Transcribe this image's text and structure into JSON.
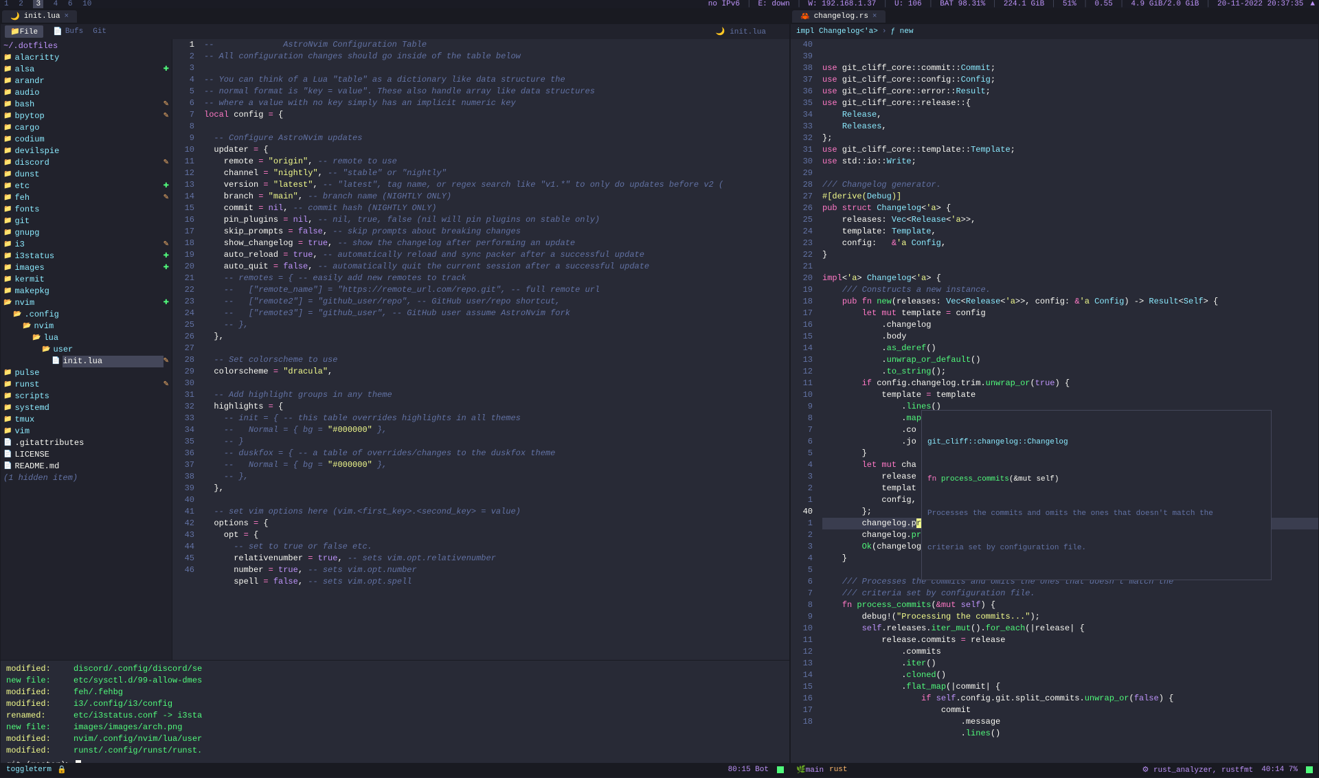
{
  "topbar": {
    "workspaces": [
      "1",
      "2",
      "3",
      "4",
      "6",
      "10"
    ],
    "active_ws": "3",
    "ipv6": "no IPv6",
    "eth": "E: down",
    "wifi": "W: 192.168.1.37",
    "up": "U: 106",
    "bat": "BAT 98.31%",
    "disk": "224.1 GiB",
    "diskpct": "51%",
    "load": "0.55",
    "mem": "4.9 GiB/2.0 GiB",
    "date": "20-11-2022 20:37:35",
    "tray": "▲"
  },
  "left": {
    "tab": {
      "name": "init.lua",
      "active": true
    },
    "mode": {
      "file": "📁File",
      "bufs": "Bufs",
      "git": "Git"
    },
    "breadcrumb": "🌙 init.lua",
    "tree": {
      "header": "~/.dotfiles",
      "items": [
        {
          "n": "alacritty",
          "i": 0,
          "t": "d",
          "m": ""
        },
        {
          "n": "alsa",
          "i": 0,
          "t": "d",
          "m": "+"
        },
        {
          "n": "arandr",
          "i": 0,
          "t": "d",
          "m": ""
        },
        {
          "n": "audio",
          "i": 0,
          "t": "d",
          "m": ""
        },
        {
          "n": "bash",
          "i": 0,
          "t": "d",
          "m": "~"
        },
        {
          "n": "bpytop",
          "i": 0,
          "t": "d",
          "m": "~"
        },
        {
          "n": "cargo",
          "i": 0,
          "t": "d",
          "m": ""
        },
        {
          "n": "codium",
          "i": 0,
          "t": "d",
          "m": ""
        },
        {
          "n": "devilspie",
          "i": 0,
          "t": "d",
          "m": ""
        },
        {
          "n": "discord",
          "i": 0,
          "t": "d",
          "m": "~"
        },
        {
          "n": "dunst",
          "i": 0,
          "t": "d",
          "m": ""
        },
        {
          "n": "etc",
          "i": 0,
          "t": "d",
          "m": "+"
        },
        {
          "n": "feh",
          "i": 0,
          "t": "d",
          "m": "~"
        },
        {
          "n": "fonts",
          "i": 0,
          "t": "d",
          "m": ""
        },
        {
          "n": "git",
          "i": 0,
          "t": "d",
          "m": ""
        },
        {
          "n": "gnupg",
          "i": 0,
          "t": "d",
          "m": ""
        },
        {
          "n": "i3",
          "i": 0,
          "t": "d",
          "m": "~"
        },
        {
          "n": "i3status",
          "i": 0,
          "t": "d",
          "m": "+"
        },
        {
          "n": "images",
          "i": 0,
          "t": "d",
          "m": "+"
        },
        {
          "n": "kermit",
          "i": 0,
          "t": "d",
          "m": ""
        },
        {
          "n": "makepkg",
          "i": 0,
          "t": "d",
          "m": ""
        },
        {
          "n": "nvim",
          "i": 0,
          "t": "d",
          "m": "+",
          "open": true
        },
        {
          "n": ".config",
          "i": 1,
          "t": "d",
          "m": "",
          "open": true
        },
        {
          "n": "nvim",
          "i": 2,
          "t": "d",
          "m": "",
          "open": true
        },
        {
          "n": "lua",
          "i": 3,
          "t": "d",
          "m": "",
          "open": true
        },
        {
          "n": "user",
          "i": 4,
          "t": "d",
          "m": "",
          "open": true
        },
        {
          "n": "init.lua",
          "i": 5,
          "t": "f",
          "m": "~",
          "sel": true
        },
        {
          "n": "pulse",
          "i": 0,
          "t": "d",
          "m": ""
        },
        {
          "n": "runst",
          "i": 0,
          "t": "d",
          "m": "~"
        },
        {
          "n": "scripts",
          "i": 0,
          "t": "d",
          "m": ""
        },
        {
          "n": "systemd",
          "i": 0,
          "t": "d",
          "m": ""
        },
        {
          "n": "tmux",
          "i": 0,
          "t": "d",
          "m": ""
        },
        {
          "n": "vim",
          "i": 0,
          "t": "d",
          "m": ""
        },
        {
          "n": ".gitattributes",
          "i": 0,
          "t": "f",
          "m": ""
        },
        {
          "n": "LICENSE",
          "i": 0,
          "t": "f",
          "m": ""
        },
        {
          "n": "README.md",
          "i": 0,
          "t": "f",
          "m": ""
        }
      ],
      "hidden": "(1 hidden item)"
    },
    "gutter": [
      "1",
      "2",
      "3",
      "4",
      "5",
      "6",
      "7",
      "8",
      "9",
      "10",
      "11",
      "12",
      "13",
      "14",
      "15",
      "16",
      "17",
      "18",
      "19",
      "20",
      "21",
      "22",
      "23",
      "24",
      "25",
      "26",
      "27",
      "28",
      "29",
      "30",
      "31",
      "32",
      "33",
      "34",
      "35",
      "36",
      "37",
      "38",
      "39",
      "40",
      "41",
      "42",
      "43",
      "44",
      "45",
      "46"
    ],
    "code_lines": [
      {
        "html": "<span class='cmt'>--              AstroNvim Configuration Table</span>"
      },
      {
        "html": "<span class='cmt'>-- All configuration changes should go inside of the table below</span>"
      },
      {
        "html": ""
      },
      {
        "html": "<span class='cmt'>-- You can think of a Lua \"table\" as a dictionary like data structure the</span>"
      },
      {
        "html": "<span class='cmt'>-- normal format is \"key = value\". These also handle array like data structures</span>"
      },
      {
        "html": "<span class='cmt'>-- where a value with no key simply has an implicit numeric key</span>"
      },
      {
        "html": "<span class='kw'>local</span> config <span class='op'>=</span> {"
      },
      {
        "html": ""
      },
      {
        "html": "  <span class='cmt'>-- Configure AstroNvim updates</span>"
      },
      {
        "html": "  updater <span class='op'>=</span> {"
      },
      {
        "html": "    remote <span class='op'>=</span> <span class='str'>\"origin\"</span>, <span class='cmt'>-- remote to use</span>"
      },
      {
        "html": "    channel <span class='op'>=</span> <span class='str'>\"nightly\"</span>, <span class='cmt'>-- \"stable\" or \"nightly\"</span>"
      },
      {
        "html": "    version <span class='op'>=</span> <span class='str'>\"latest\"</span>, <span class='cmt'>-- \"latest\", tag name, or regex search like \"v1.*\" to only do updates before v2 (</span>"
      },
      {
        "html": "    branch <span class='op'>=</span> <span class='str'>\"main\"</span>, <span class='cmt'>-- branch name (NIGHTLY ONLY)</span>"
      },
      {
        "html": "    commit <span class='op'>=</span> <span class='bool'>nil</span>, <span class='cmt'>-- commit hash (NIGHTLY ONLY)</span>"
      },
      {
        "html": "    pin_plugins <span class='op'>=</span> <span class='bool'>nil</span>, <span class='cmt'>-- nil, true, false (nil will pin plugins on stable only)</span>"
      },
      {
        "html": "    skip_prompts <span class='op'>=</span> <span class='bool'>false</span>, <span class='cmt'>-- skip prompts about breaking changes</span>"
      },
      {
        "html": "    show_changelog <span class='op'>=</span> <span class='bool'>true</span>, <span class='cmt'>-- show the changelog after performing an update</span>"
      },
      {
        "html": "    auto_reload <span class='op'>=</span> <span class='bool'>true</span>, <span class='cmt'>-- automatically reload and sync packer after a successful update</span>"
      },
      {
        "html": "    auto_quit <span class='op'>=</span> <span class='bool'>false</span>, <span class='cmt'>-- automatically quit the current session after a successful update</span>"
      },
      {
        "html": "    <span class='cmt'>-- remotes = { -- easily add new remotes to track</span>"
      },
      {
        "html": "    <span class='cmt'>--   [\"remote_name\"] = \"https://remote_url.com/repo.git\", -- full remote url</span>"
      },
      {
        "html": "    <span class='cmt'>--   [\"remote2\"] = \"github_user/repo\", -- GitHub user/repo shortcut,</span>"
      },
      {
        "html": "    <span class='cmt'>--   [\"remote3\"] = \"github_user\", -- GitHub user assume AstroNvim fork</span>"
      },
      {
        "html": "    <span class='cmt'>-- },</span>"
      },
      {
        "html": "  },"
      },
      {
        "html": ""
      },
      {
        "html": "  <span class='cmt'>-- Set colorscheme to use</span>"
      },
      {
        "html": "  colorscheme <span class='op'>=</span> <span class='str'>\"dracula\"</span>,"
      },
      {
        "html": ""
      },
      {
        "html": "  <span class='cmt'>-- Add highlight groups in any theme</span>"
      },
      {
        "html": "  highlights <span class='op'>=</span> {"
      },
      {
        "html": "    <span class='cmt'>-- init = { -- this table overrides highlights in all themes</span>"
      },
      {
        "html": "    <span class='cmt'>--   Normal = { bg = </span><span class='str'>\"#000000\"</span><span class='cmt'> },</span>"
      },
      {
        "html": "    <span class='cmt'>-- }</span>"
      },
      {
        "html": "    <span class='cmt'>-- duskfox = { -- a table of overrides/changes to the duskfox theme</span>"
      },
      {
        "html": "    <span class='cmt'>--   Normal = { bg = </span><span class='str'>\"#000000\"</span><span class='cmt'> },</span>"
      },
      {
        "html": "    <span class='cmt'>-- },</span>"
      },
      {
        "html": "  },"
      },
      {
        "html": ""
      },
      {
        "html": "  <span class='cmt'>-- set vim options here (vim.&lt;first_key&gt;.&lt;second_key&gt; = value)</span>"
      },
      {
        "html": "  options <span class='op'>=</span> {"
      },
      {
        "html": "    opt <span class='op'>=</span> {"
      },
      {
        "html": "      <span class='cmt'>-- set to true or false etc.</span>"
      },
      {
        "html": "      relativenumber <span class='op'>=</span> <span class='bool'>true</span>, <span class='cmt'>-- sets vim.opt.relativenumber</span>"
      },
      {
        "html": "      number <span class='op'>=</span> <span class='bool'>true</span>, <span class='cmt'>-- sets vim.opt.number</span>"
      },
      {
        "html": "      spell <span class='op'>=</span> <span class='bool'>false</span>, <span class='cmt'>-- sets vim.opt.spell</span>"
      }
    ],
    "git": [
      {
        "s": "modified:",
        "p": "discord/.config/discord/se"
      },
      {
        "s": "new file:",
        "p": "etc/sysctl.d/99-allow-dmes"
      },
      {
        "s": "modified:",
        "p": "feh/.fehbg"
      },
      {
        "s": "modified:",
        "p": "i3/.config/i3/config"
      },
      {
        "s": "renamed:",
        "p": "etc/i3status.conf -> i3sta"
      },
      {
        "s": "new file:",
        "p": "images/images/arch.png"
      },
      {
        "s": "modified:",
        "p": "nvim/.config/nvim/lua/user"
      },
      {
        "s": "modified:",
        "p": "runst/.config/runst/runst."
      }
    ],
    "prompt": "git (master)>",
    "status": {
      "term": "toggleterm",
      "lock": "🔒",
      "pos": "80:15 Bot"
    }
  },
  "right": {
    "tab": {
      "name": "changelog.rs"
    },
    "crumb": {
      "impl": "impl Changelog<'a>",
      "fn": "ƒ new"
    },
    "gutter": [
      "40",
      "39",
      "38",
      "37",
      "36",
      "35",
      "34",
      "33",
      "32",
      "31",
      "30",
      "29",
      "28",
      "27",
      "26",
      "25",
      "24",
      "23",
      "22",
      "21",
      "20",
      "19",
      "18",
      "17",
      "16",
      "15",
      "14",
      "13",
      "12",
      "11",
      "10",
      "9",
      "8",
      "7",
      "6",
      "5",
      "4",
      "3",
      "2",
      "1",
      "40",
      "1",
      "2",
      "3",
      "4",
      "5",
      "6",
      "7",
      "8",
      "9",
      "10",
      "11",
      "12",
      "13",
      "14",
      "15",
      "16",
      "17",
      "18"
    ],
    "current_abs": "40",
    "code_lines": [
      {
        "html": "<span class='kw'>use</span> git_cliff_core::commit::<span class='type'>Commit</span>;"
      },
      {
        "html": "<span class='kw'>use</span> git_cliff_core::config::<span class='type'>Config</span>;"
      },
      {
        "html": "<span class='kw'>use</span> git_cliff_core::error::<span class='type'>Result</span>;"
      },
      {
        "html": "<span class='kw'>use</span> git_cliff_core::release::{"
      },
      {
        "html": "    <span class='type'>Release</span>,"
      },
      {
        "html": "    <span class='type'>Releases</span>,"
      },
      {
        "html": "};"
      },
      {
        "html": "<span class='kw'>use</span> git_cliff_core::template::<span class='type'>Template</span>;"
      },
      {
        "html": "<span class='kw'>use</span> std::io::<span class='type'>Write</span>;"
      },
      {
        "html": ""
      },
      {
        "html": "<span class='cmt'>/// Changelog generator.</span>"
      },
      {
        "html": "<span class='dc-yellow'>#[derive(</span><span class='type'>Debug</span><span class='dc-yellow'>)]</span>"
      },
      {
        "html": "<span class='kw'>pub struct</span> <span class='type'>Changelog</span>&lt;<span class='str'>'a</span>&gt; {"
      },
      {
        "html": "    releases: <span class='type'>Vec</span>&lt;<span class='type'>Release</span>&lt;<span class='str'>'a</span>&gt;&gt;,"
      },
      {
        "html": "    template: <span class='type'>Template</span>,"
      },
      {
        "html": "    config:   <span class='op'>&amp;</span><span class='str'>'a</span> <span class='type'>Config</span>,"
      },
      {
        "html": "}"
      },
      {
        "html": ""
      },
      {
        "html": "<span class='kw'>impl</span>&lt;<span class='str'>'a</span>&gt; <span class='type'>Changelog</span>&lt;<span class='str'>'a</span>&gt; {"
      },
      {
        "html": "    <span class='cmt'>/// Constructs a new instance.</span>"
      },
      {
        "html": "    <span class='kw'>pub fn</span> <span class='fn'>new</span>(releases: <span class='type'>Vec</span>&lt;<span class='type'>Release</span>&lt;<span class='str'>'a</span>&gt;&gt;, config: <span class='op'>&amp;</span><span class='str'>'a</span> <span class='type'>Config</span>) -&gt; <span class='type'>Result</span>&lt;<span class='type'>Self</span>&gt; {"
      },
      {
        "html": "        <span class='kw'>let</span> <span class='kw'>mut</span> template <span class='op'>=</span> config"
      },
      {
        "html": "            .changelog"
      },
      {
        "html": "            .body"
      },
      {
        "html": "            .<span class='fn'>as_deref</span>()"
      },
      {
        "html": "            .<span class='fn'>unwrap_or_default</span>()"
      },
      {
        "html": "            .<span class='fn'>to_string</span>();"
      },
      {
        "html": "        <span class='kw'>if</span> config.changelog.trim.<span class='fn'>unwrap_or</span>(<span class='bool'>true</span>) {"
      },
      {
        "html": "            template <span class='op'>=</span> template"
      },
      {
        "html": "                .<span class='fn'>lines</span>()"
      },
      {
        "html": "                .<span class='fn'>map</span>(|v| v.<span class='fn'>trim</span>())"
      },
      {
        "html": "                .co"
      },
      {
        "html": "                .jo"
      },
      {
        "html": "        }"
      },
      {
        "html": "        <span class='kw'>let</span> <span class='kw'>mut</span> cha"
      },
      {
        "html": "            release"
      },
      {
        "html": "            templat"
      },
      {
        "html": "            config,"
      },
      {
        "html": "        };"
      },
      {
        "html": "<span class='hl-line'>        changelog.p<span style='background:#f1fa8c;color:#282a36'>r</span><span class='cmt'>ocess_commits</span>();</span>"
      },
      {
        "html": "        changelog.<span class='fn'>process_releases</span>();"
      },
      {
        "html": "        <span class='fn'>Ok</span>(changelog)"
      },
      {
        "html": "    }"
      },
      {
        "html": ""
      },
      {
        "html": "    <span class='cmt'>/// Processes the commits and omits the ones that doesn't match the</span>"
      },
      {
        "html": "    <span class='cmt'>/// criteria set by configuration file.</span>"
      },
      {
        "html": "    <span class='kw'>fn</span> <span class='fn'>process_commits</span>(<span class='op'>&amp;</span><span class='kw'>mut</span> <span class='bool'>self</span>) {"
      },
      {
        "html": "        debug!(<span class='str'>\"Processing the commits...\"</span>);"
      },
      {
        "html": "        <span class='bool'>self</span>.releases.<span class='fn'>iter_mut</span>().<span class='fn'>for_each</span>(|release| {"
      },
      {
        "html": "            release.commits <span class='op'>=</span> release"
      },
      {
        "html": "                .commits"
      },
      {
        "html": "                .<span class='fn'>iter</span>()"
      },
      {
        "html": "                .<span class='fn'>cloned</span>()"
      },
      {
        "html": "                .<span class='fn'>flat_map</span>(|commit| {"
      },
      {
        "html": "                    <span class='kw'>if</span> <span class='bool'>self</span>.config.git.split_commits.<span class='fn'>unwrap_or</span>(<span class='bool'>false</span>) {"
      },
      {
        "html": "                        commit"
      },
      {
        "html": "                            .message"
      },
      {
        "html": "                            .<span class='fn'>lines</span>()"
      }
    ],
    "hover": {
      "title": "git_cliff::changelog::Changelog",
      "sig": "fn process_commits(&mut self)",
      "doc1": "Processes the commits and omits the ones that doesn't match the",
      "doc2": "criteria set by configuration file."
    },
    "status": {
      "branch": "main",
      "ft": "rust",
      "lsp": "rust_analyzer, rustfmt",
      "pos": "40:14 7%"
    }
  }
}
